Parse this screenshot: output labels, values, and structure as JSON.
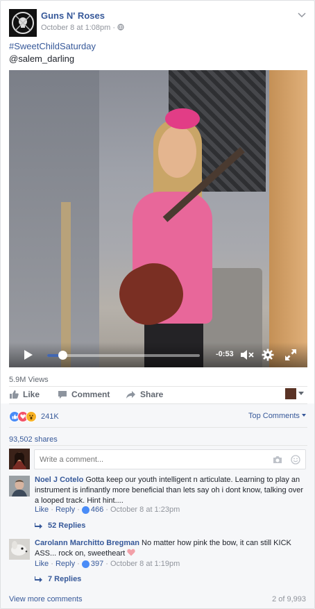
{
  "post": {
    "page_name": "Guns N' Roses",
    "timestamp": "October 8 at 1:08pm",
    "privacy_separator": "·",
    "hashtag": "#SweetChildSaturday",
    "mention": "@salem_darling"
  },
  "video": {
    "time_remaining": "-0:53",
    "progress": 0.1
  },
  "stats": {
    "views": "5.9M Views",
    "reactions_count": "241K",
    "shares": "93,502 shares"
  },
  "actions": {
    "like": "Like",
    "comment": "Comment",
    "share": "Share"
  },
  "comments_header": {
    "top_comments": "Top Comments",
    "placeholder": "Write a comment..."
  },
  "comments": [
    {
      "author": "Noel J Cotelo",
      "text": "Gotta keep our youth intelligent n articulate. Learning to play an instrument is infinantly more beneficial than lets say oh i dont know, talking over a looped track. Hint hint....",
      "like_label": "Like",
      "reply_label": "Reply",
      "likes": "466",
      "time": "October 8 at 1:23pm",
      "replies": "52 Replies"
    },
    {
      "author": "Carolann Marchitto Bregman",
      "text": "No matter how pink the bow, it can still KICK ASS... rock on, sweetheart ",
      "like_label": "Like",
      "reply_label": "Reply",
      "likes": "397",
      "time": "October 8 at 1:19pm",
      "replies": "7 Replies"
    }
  ],
  "footer": {
    "view_more": "View more comments",
    "pager": "2 of 9,993"
  },
  "colors": {
    "link": "#365899",
    "like_blue": "#4a8cf7",
    "love_red": "#f25268",
    "wow_yellow": "#f7b125",
    "progress_blue": "#4267b2"
  }
}
